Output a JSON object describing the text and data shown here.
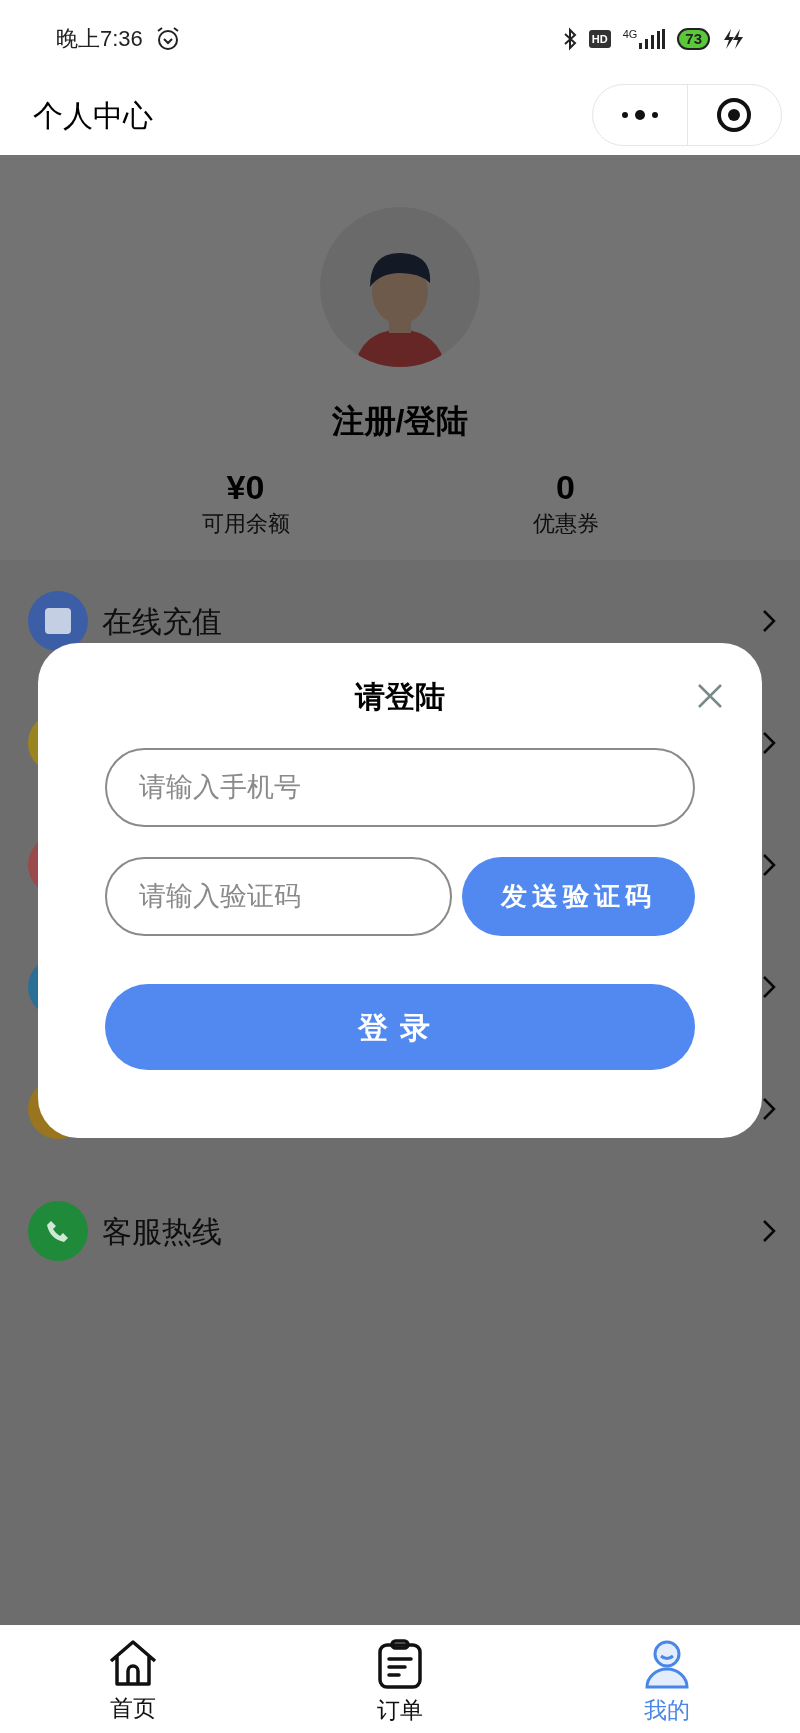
{
  "status_bar": {
    "time": "晚上7:36",
    "hd": "HD",
    "network": "4G",
    "battery": "73"
  },
  "header": {
    "title": "个人中心"
  },
  "profile": {
    "name": "注册/登陆",
    "stats": [
      {
        "value": "¥0",
        "label": "可用余额"
      },
      {
        "value": "0",
        "label": "优惠券"
      }
    ]
  },
  "menu": [
    {
      "label": "在线充值",
      "color": "#3c5ea6"
    },
    {
      "color": "#9a8420"
    },
    {
      "color": "#9a4a4a"
    },
    {
      "color": "#2a6f96"
    },
    {
      "color": "#9a7520"
    },
    {
      "label": "客服热线",
      "color": "#1f8a3a"
    }
  ],
  "dialog": {
    "title": "请登陆",
    "phone": {
      "placeholder": "请输入手机号"
    },
    "code": {
      "placeholder": "请输入验证码"
    },
    "send_button": "发送验证码",
    "login_button": "登录"
  },
  "tabs": [
    {
      "label": "首页",
      "selected": false
    },
    {
      "label": "订单",
      "selected": false
    },
    {
      "label": "我的",
      "selected": true
    }
  ]
}
